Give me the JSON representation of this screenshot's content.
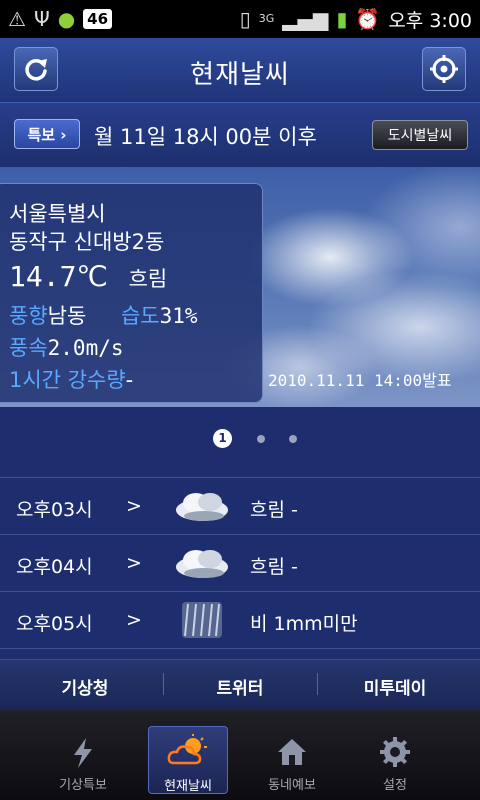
{
  "statusbar": {
    "notification_count": "46",
    "network": "3G",
    "time": "오후 3:00"
  },
  "titlebar": {
    "title": "현재날씨"
  },
  "infobar": {
    "special_button": "특보 ›",
    "date_text": "월 11일 18시 00분 이후",
    "city_button": "도시별날씨"
  },
  "current": {
    "city": "서울특별시",
    "district": "동작구 신대방2동",
    "temperature": "14.7℃",
    "condition": "흐림",
    "wind_dir_label": "풍향",
    "wind_dir_value": "남동",
    "humidity_label": "습도",
    "humidity_value": "31%",
    "wind_speed_label": "풍속",
    "wind_speed_value": "2.0m/s",
    "precip_label": "1시간 강수량",
    "precip_value": "-",
    "issued": "2010.11.11 14:00발표"
  },
  "pager": {
    "current": "1",
    "total": 3
  },
  "forecast": [
    {
      "time": "오후03시",
      "arrow": ">",
      "icon": "cloudy-icon",
      "condition": "흐림 -"
    },
    {
      "time": "오후04시",
      "arrow": ">",
      "icon": "cloudy-icon",
      "condition": "흐림 -"
    },
    {
      "time": "오후05시",
      "arrow": ">",
      "icon": "rain-icon",
      "condition": "비 1mm미만"
    }
  ],
  "links": [
    "기상청",
    "트위터",
    "미투데이"
  ],
  "tabs": [
    {
      "label": "기상특보",
      "icon": "lightning-icon",
      "active": false
    },
    {
      "label": "현재날씨",
      "icon": "sun-cloud-icon",
      "active": true
    },
    {
      "label": "동네예보",
      "icon": "house-icon",
      "active": false
    },
    {
      "label": "설정",
      "icon": "gear-icon",
      "active": false
    }
  ],
  "colors": {
    "accent_blue": "#5aa8ff",
    "background": "#1e2d6e"
  }
}
